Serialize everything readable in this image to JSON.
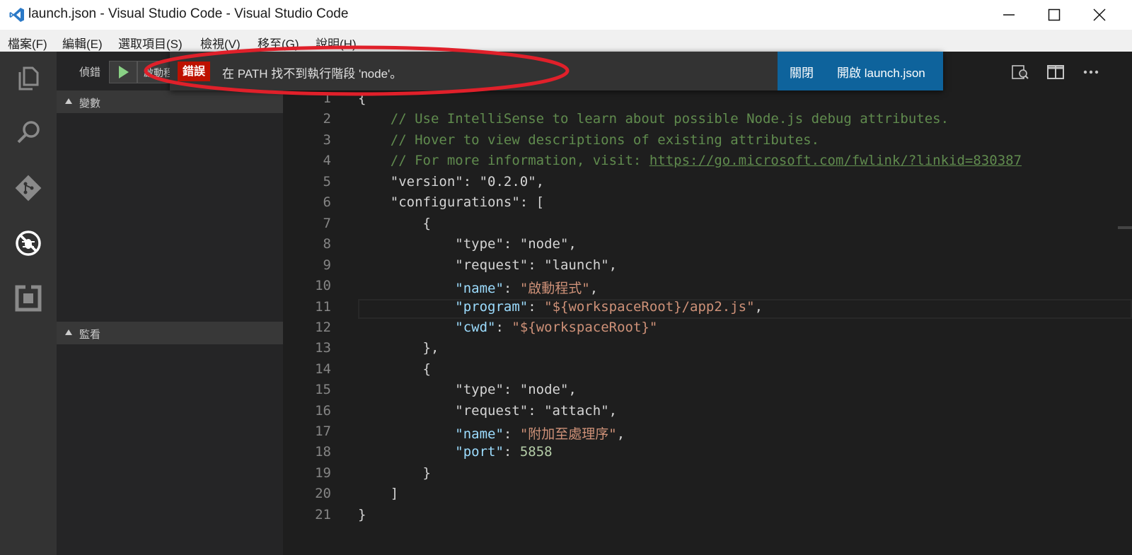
{
  "window": {
    "title": "launch.json - Visual Studio Code - Visual Studio Code"
  },
  "menu": [
    "檔案(F)",
    "編輯(E)",
    "選取項目(S)",
    "檢視(V)",
    "移至(G)",
    "說明(H)"
  ],
  "activity_bar": [
    "files-icon",
    "search-icon",
    "git-icon",
    "debug-icon",
    "extensions-icon"
  ],
  "sidebar": {
    "title": "偵錯",
    "config_select": "啟動程式",
    "sections": [
      "變數",
      "監看"
    ]
  },
  "notification": {
    "badge": "錯誤",
    "message": "在 PATH 找不到執行階段 'node'。",
    "actions": [
      "關閉",
      "開啟 launch.json"
    ]
  },
  "editor": {
    "line_numbers": [
      "1",
      "2",
      "3",
      "4",
      "5",
      "6",
      "7",
      "8",
      "9",
      "10",
      "11",
      "12",
      "13",
      "14",
      "15",
      "16",
      "17",
      "18",
      "19",
      "20",
      "21"
    ],
    "comment1": "// Use IntelliSense to learn about possible Node.js debug attributes.",
    "comment2": "// Hover to view descriptions of existing attributes.",
    "comment3": "// For more information, visit: ",
    "link": "https://go.microsoft.com/fwlink/?linkid=830387",
    "version": "0.2.0",
    "config1": {
      "type": "node",
      "request": "launch",
      "name": "啟動程式",
      "program": "${workspaceRoot}/app2.js",
      "cwd": "${workspaceRoot}"
    },
    "config2": {
      "type": "node",
      "request": "attach",
      "name": "附加至處理序",
      "port": "5858"
    }
  },
  "colors": {
    "accent": "#0e639c",
    "error": "#be1100",
    "annotation": "#e0202a"
  }
}
